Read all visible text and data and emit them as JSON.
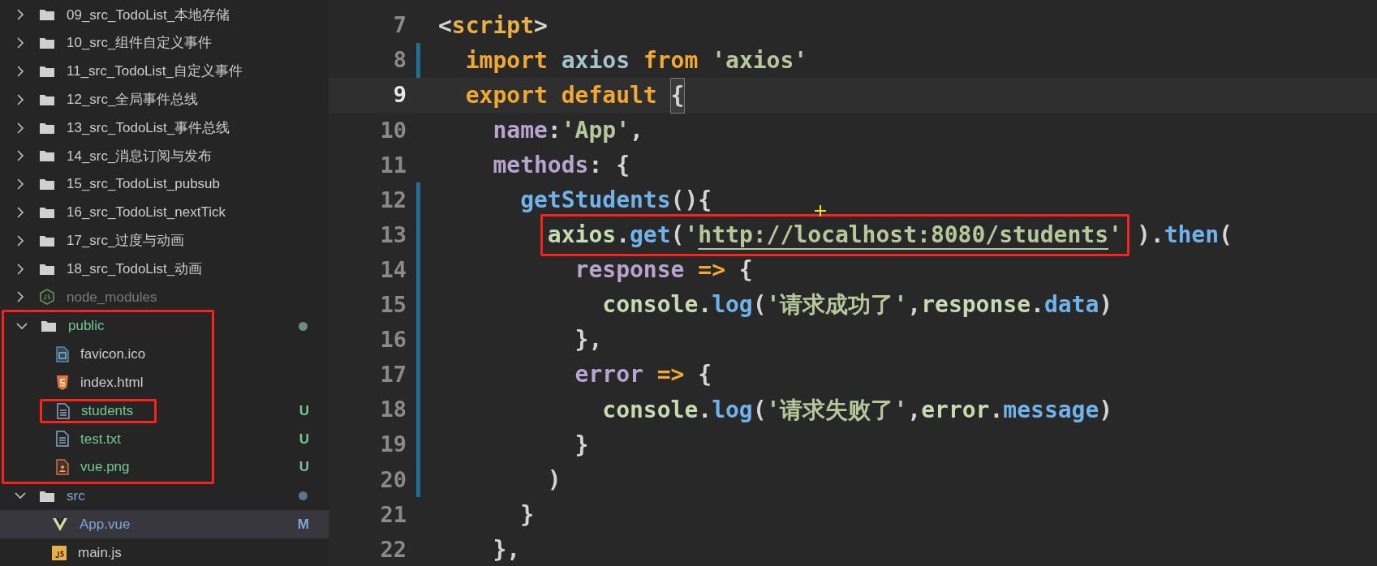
{
  "sidebar": {
    "tree": [
      {
        "kind": "folder",
        "name": "09_src_TodoList_本地存储",
        "expanded": false
      },
      {
        "kind": "folder",
        "name": "10_src_组件自定义事件",
        "expanded": false
      },
      {
        "kind": "folder",
        "name": "11_src_TodoList_自定义事件",
        "expanded": false
      },
      {
        "kind": "folder",
        "name": "12_src_全局事件总线",
        "expanded": false
      },
      {
        "kind": "folder",
        "name": "13_src_TodoList_事件总线",
        "expanded": false
      },
      {
        "kind": "folder",
        "name": "14_src_消息订阅与发布",
        "expanded": false
      },
      {
        "kind": "folder",
        "name": "15_src_TodoList_pubsub",
        "expanded": false
      },
      {
        "kind": "folder",
        "name": "16_src_TodoList_nextTick",
        "expanded": false
      },
      {
        "kind": "folder",
        "name": "17_src_过度与动画",
        "expanded": false
      },
      {
        "kind": "folder",
        "name": "18_src_TodoList_动画",
        "expanded": false
      },
      {
        "kind": "module-folder",
        "name": "node_modules",
        "expanded": false,
        "color": "#7a7a7a"
      },
      {
        "kind": "folder",
        "name": "public",
        "expanded": true,
        "color": "#73c991",
        "dot": {
          "color": "#6b8f7a"
        },
        "annotated": true,
        "children": [
          {
            "kind": "ico",
            "name": "favicon.ico",
            "annotated": false
          },
          {
            "kind": "html",
            "name": "index.html",
            "annotated": false
          },
          {
            "kind": "text",
            "name": "students",
            "color": "#73c991",
            "badge": "U",
            "annotated": true
          },
          {
            "kind": "text",
            "name": "test.txt",
            "color": "#73c991",
            "badge": "U",
            "annotated": false
          },
          {
            "kind": "image",
            "name": "vue.png",
            "color": "#73c991",
            "badge": "U",
            "annotated": false
          }
        ]
      },
      {
        "kind": "folder",
        "name": "src",
        "expanded": true,
        "color": "#7ea6d6",
        "dot": {
          "color": "#5a7390"
        },
        "annotated": false,
        "children": [
          {
            "kind": "vue",
            "name": "App.vue",
            "color": "#7ea6d6",
            "badge": "M",
            "selected": true
          },
          {
            "kind": "js",
            "name": "main.js",
            "selected": false
          }
        ]
      }
    ]
  },
  "editor": {
    "lines": [
      {
        "number": "7",
        "current": false,
        "modified": false,
        "tokens": [
          {
            "kind": "punct",
            "text": "<"
          },
          {
            "kind": "tag",
            "text": "script"
          },
          {
            "kind": "punct",
            "text": ">"
          }
        ]
      },
      {
        "number": "8",
        "current": false,
        "modified": true,
        "tokens": [
          {
            "kind": "keyword",
            "text": "  import "
          },
          {
            "kind": "ident",
            "text": "axios "
          },
          {
            "kind": "keyword",
            "text": "from "
          },
          {
            "kind": "string",
            "text": "'axios'"
          }
        ]
      },
      {
        "number": "9",
        "current": true,
        "modified": false,
        "tokens": [
          {
            "kind": "keyword",
            "text": "  export default "
          },
          {
            "kind": "bracket",
            "text": "{"
          }
        ]
      },
      {
        "number": "10",
        "current": false,
        "modified": false,
        "tokens": [
          {
            "kind": "property",
            "text": "    name"
          },
          {
            "kind": "punct",
            "text": ":"
          },
          {
            "kind": "string",
            "text": "'App'"
          },
          {
            "kind": "punct",
            "text": ","
          }
        ]
      },
      {
        "number": "11",
        "current": false,
        "modified": false,
        "tokens": [
          {
            "kind": "property",
            "text": "    methods"
          },
          {
            "kind": "punct",
            "text": ": {"
          }
        ]
      },
      {
        "number": "12",
        "current": false,
        "modified": true,
        "tokens": [
          {
            "kind": "function",
            "text": "      getStudents"
          },
          {
            "kind": "punct",
            "text": "(){"
          }
        ]
      },
      {
        "number": "13",
        "current": false,
        "modified": true,
        "tokens": [
          {
            "kind": "highlight",
            "tokens": [
              {
                "kind": "variable",
                "text": "axios"
              },
              {
                "kind": "punct",
                "text": "."
              },
              {
                "kind": "function",
                "text": "get"
              },
              {
                "kind": "punct",
                "text": "("
              },
              {
                "kind": "string",
                "text": "'"
              },
              {
                "kind": "link",
                "text": "http://localhost:8080/students"
              },
              {
                "kind": "string",
                "text": "'"
              }
            ]
          },
          {
            "kind": "punct",
            "text": ")."
          },
          {
            "kind": "function",
            "text": "then"
          },
          {
            "kind": "punct",
            "text": "("
          }
        ]
      },
      {
        "number": "14",
        "current": false,
        "modified": true,
        "tokens": [
          {
            "kind": "property",
            "text": "          response "
          },
          {
            "kind": "keyword",
            "text": "=>"
          },
          {
            "kind": "punct",
            "text": " {"
          }
        ]
      },
      {
        "number": "15",
        "current": false,
        "modified": true,
        "tokens": [
          {
            "kind": "variable",
            "text": "            console"
          },
          {
            "kind": "punct",
            "text": "."
          },
          {
            "kind": "function",
            "text": "log"
          },
          {
            "kind": "punct",
            "text": "("
          },
          {
            "kind": "string",
            "text": "'请求成功了'"
          },
          {
            "kind": "punct",
            "text": ","
          },
          {
            "kind": "variable",
            "text": "response"
          },
          {
            "kind": "punct",
            "text": "."
          },
          {
            "kind": "function",
            "text": "data"
          },
          {
            "kind": "punct",
            "text": ")"
          }
        ]
      },
      {
        "number": "16",
        "current": false,
        "modified": true,
        "tokens": [
          {
            "kind": "punct",
            "text": "          },"
          }
        ]
      },
      {
        "number": "17",
        "current": false,
        "modified": true,
        "tokens": [
          {
            "kind": "property",
            "text": "          error "
          },
          {
            "kind": "keyword",
            "text": "=>"
          },
          {
            "kind": "punct",
            "text": " {"
          }
        ]
      },
      {
        "number": "18",
        "current": false,
        "modified": true,
        "tokens": [
          {
            "kind": "variable",
            "text": "            console"
          },
          {
            "kind": "punct",
            "text": "."
          },
          {
            "kind": "function",
            "text": "log"
          },
          {
            "kind": "punct",
            "text": "("
          },
          {
            "kind": "string",
            "text": "'请求失败了'"
          },
          {
            "kind": "punct",
            "text": ","
          },
          {
            "kind": "variable",
            "text": "error"
          },
          {
            "kind": "punct",
            "text": "."
          },
          {
            "kind": "function",
            "text": "message"
          },
          {
            "kind": "punct",
            "text": ")"
          }
        ]
      },
      {
        "number": "19",
        "current": false,
        "modified": true,
        "tokens": [
          {
            "kind": "punct",
            "text": "          }"
          }
        ]
      },
      {
        "number": "20",
        "current": false,
        "modified": true,
        "tokens": [
          {
            "kind": "punct",
            "text": "        )"
          }
        ]
      },
      {
        "number": "21",
        "current": false,
        "modified": false,
        "tokens": [
          {
            "kind": "punct",
            "text": "      }"
          }
        ]
      },
      {
        "number": "22",
        "current": false,
        "modified": false,
        "tokens": [
          {
            "kind": "punct",
            "text": "    },"
          }
        ]
      }
    ]
  }
}
